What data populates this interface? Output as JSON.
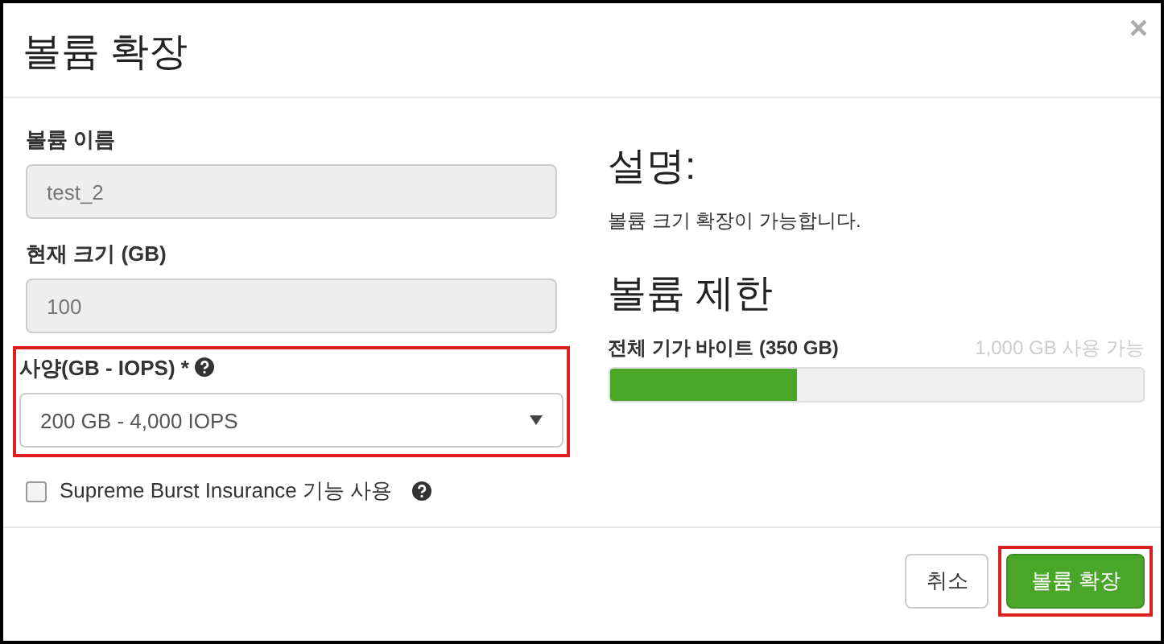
{
  "window": {
    "title": "볼륨 확장",
    "close": "×"
  },
  "fields": [
    {
      "kind": "text",
      "label": "볼륨 이름",
      "value": "test_2",
      "disabled": true,
      "highlighted": false
    },
    {
      "kind": "text",
      "label": "현재 크기 (GB)",
      "value": "100",
      "disabled": true,
      "highlighted": false
    },
    {
      "kind": "select",
      "label": "사양(GB - IOPS) *",
      "value": "200 GB - 4,000 IOPS",
      "disabled": false,
      "highlighted": true
    }
  ],
  "checkbox": {
    "label": "Supreme Burst Insurance 기능 사용",
    "checked": false
  },
  "description": {
    "heading": "설명:",
    "text": "볼륨 크기 확장이 가능합니다."
  },
  "limits": {
    "heading": "볼륨 제한",
    "label": "전체 기가 바이트 (350 GB)",
    "available": "1,000 GB 사용 가능",
    "level": 0.35
  },
  "buttons": [
    {
      "kind": "cancel",
      "label": "취소",
      "highlighted": false
    },
    {
      "kind": "primary",
      "label": "볼륨 확장",
      "highlighted": true
    }
  ]
}
